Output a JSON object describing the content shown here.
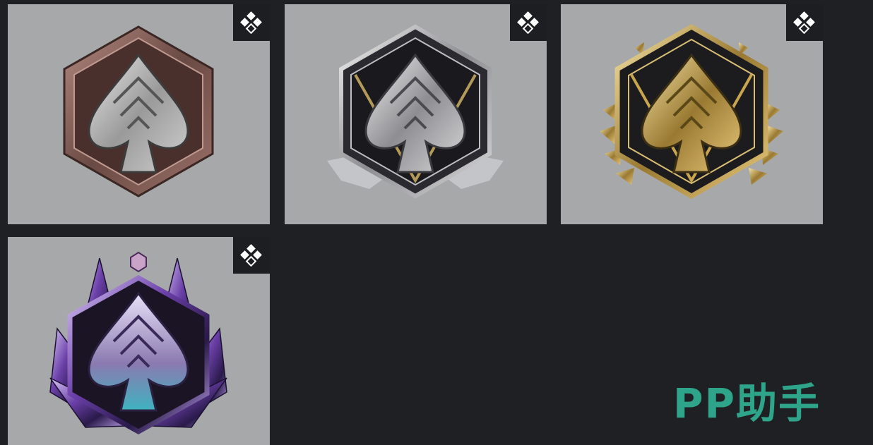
{
  "background_color": "#1f2024",
  "card_color": "#a7a8aa",
  "cards": [
    {
      "tier": "bronze",
      "icon": "spade-emblem-bronze-icon",
      "corner_icon": "diamond-grid-icon"
    },
    {
      "tier": "silver",
      "icon": "spade-emblem-silver-icon",
      "corner_icon": "diamond-grid-icon"
    },
    {
      "tier": "gold",
      "icon": "spade-emblem-gold-icon",
      "corner_icon": "diamond-grid-icon"
    },
    {
      "tier": "iridescent",
      "icon": "spade-emblem-iridescent-icon",
      "corner_icon": "diamond-grid-icon"
    }
  ],
  "watermark": {
    "text": "PP助手",
    "color": "#2ea58a"
  }
}
